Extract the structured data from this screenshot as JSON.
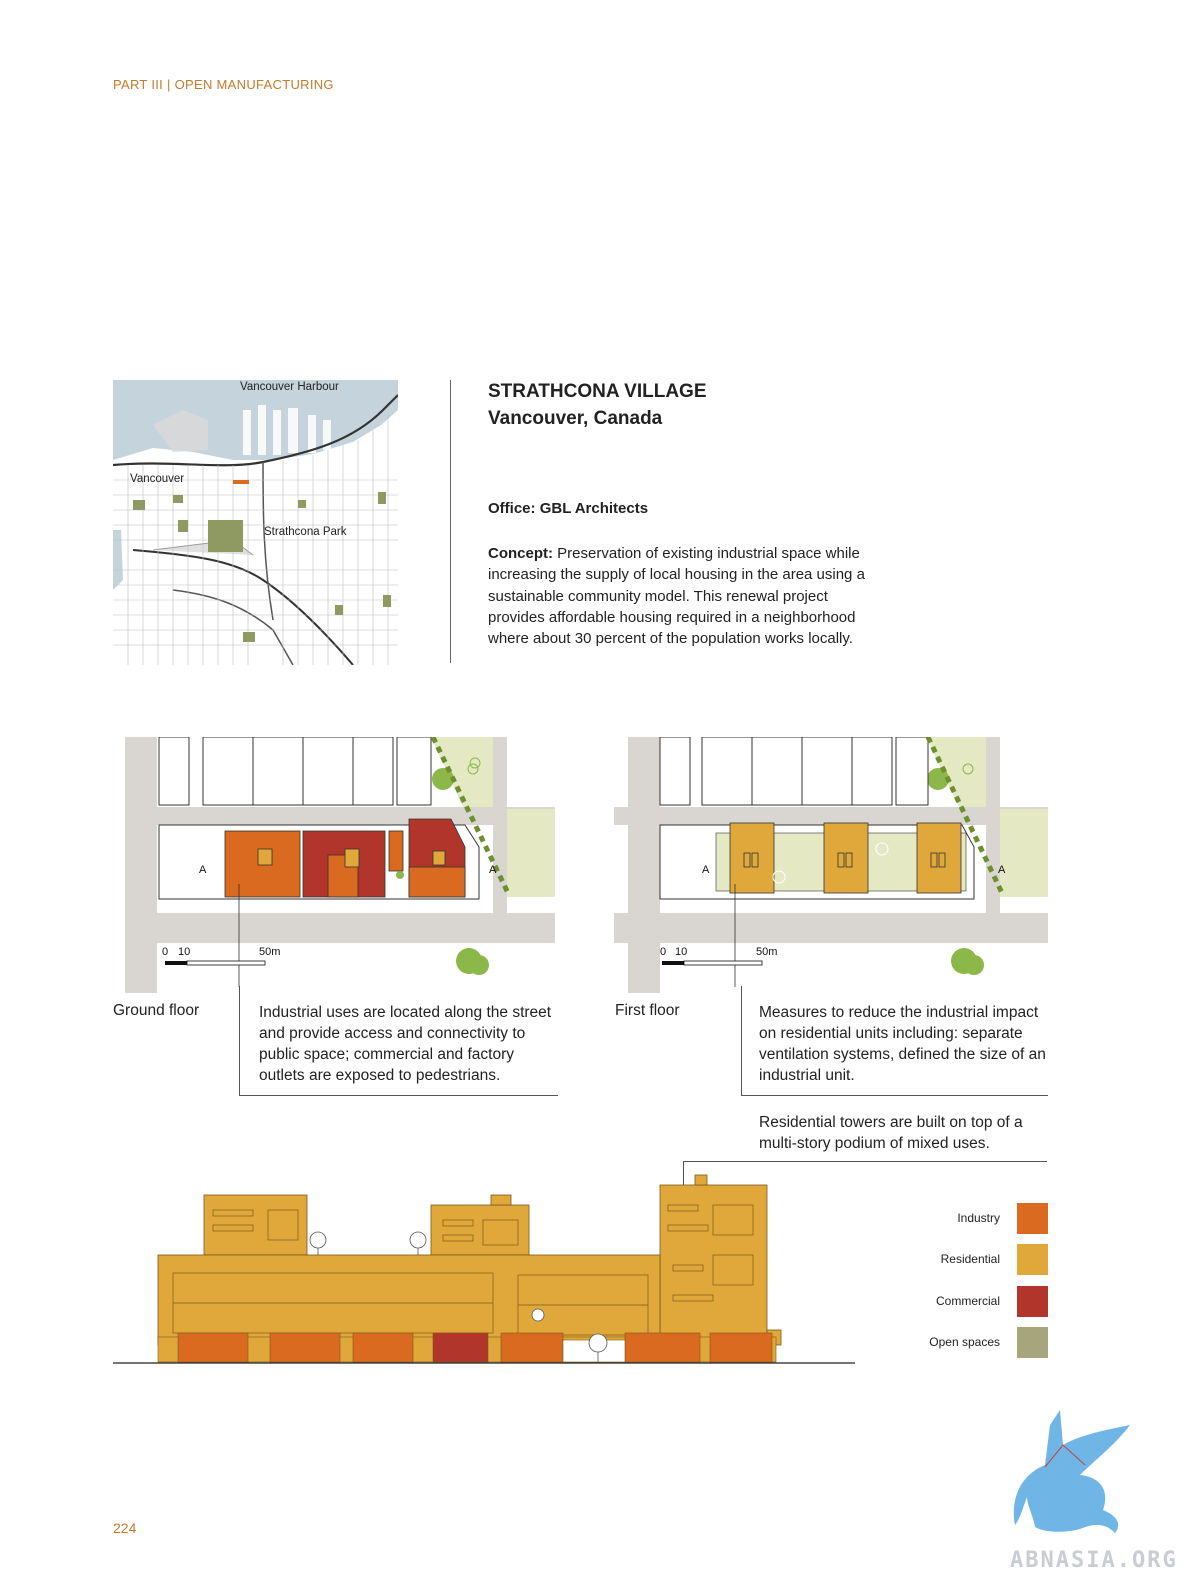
{
  "header": {
    "running_head": "PART III | OPEN MANUFACTURING",
    "page_number": "224"
  },
  "project": {
    "name": "STRATHCONA VILLAGE",
    "location": "Vancouver, Canada",
    "office_label": "Office:",
    "office_value": "GBL Architects",
    "concept_label": "Concept:",
    "concept_text": "Preservation of existing industrial space while increasing the supply of local housing in the area using a sustainable community model. This renewal project provides affordable housing required in a neighborhood where about 30 percent of the population works locally."
  },
  "map": {
    "labels": {
      "harbour": "Vancouver Harbour",
      "city": "Vancouver",
      "park": "Strathcona Park"
    },
    "colors": {
      "water": "#c5d3dc",
      "park": "#8e9a62",
      "site": "#d96a1f"
    }
  },
  "plans": {
    "ground": {
      "label": "Ground floor",
      "caption": "Industrial uses are located along the street and provide access and connectivity to public space; commercial and factory outlets are exposed to pedestrians.",
      "section_mark": "A",
      "scale": {
        "zero": "0",
        "ten": "10",
        "fifty": "50m"
      }
    },
    "first": {
      "label": "First floor",
      "caption": "Measures to reduce the industrial impact on residential units including: separate ventilation systems, defined the size of an industrial unit.",
      "section_mark": "A",
      "scale": {
        "zero": "0",
        "ten": "10",
        "fifty": "50m"
      }
    }
  },
  "elevation": {
    "caption": "Residential towers are built on top of a multi-story podium of mixed uses."
  },
  "legend": [
    {
      "label": "Industry",
      "color": "#d96a1f"
    },
    {
      "label": "Residential",
      "color": "#e0a83a"
    },
    {
      "label": "Commercial",
      "color": "#b2352b"
    },
    {
      "label": "Open spaces",
      "color": "#a6a57c"
    }
  ],
  "watermark": {
    "text": "ABNASIA.ORG"
  }
}
